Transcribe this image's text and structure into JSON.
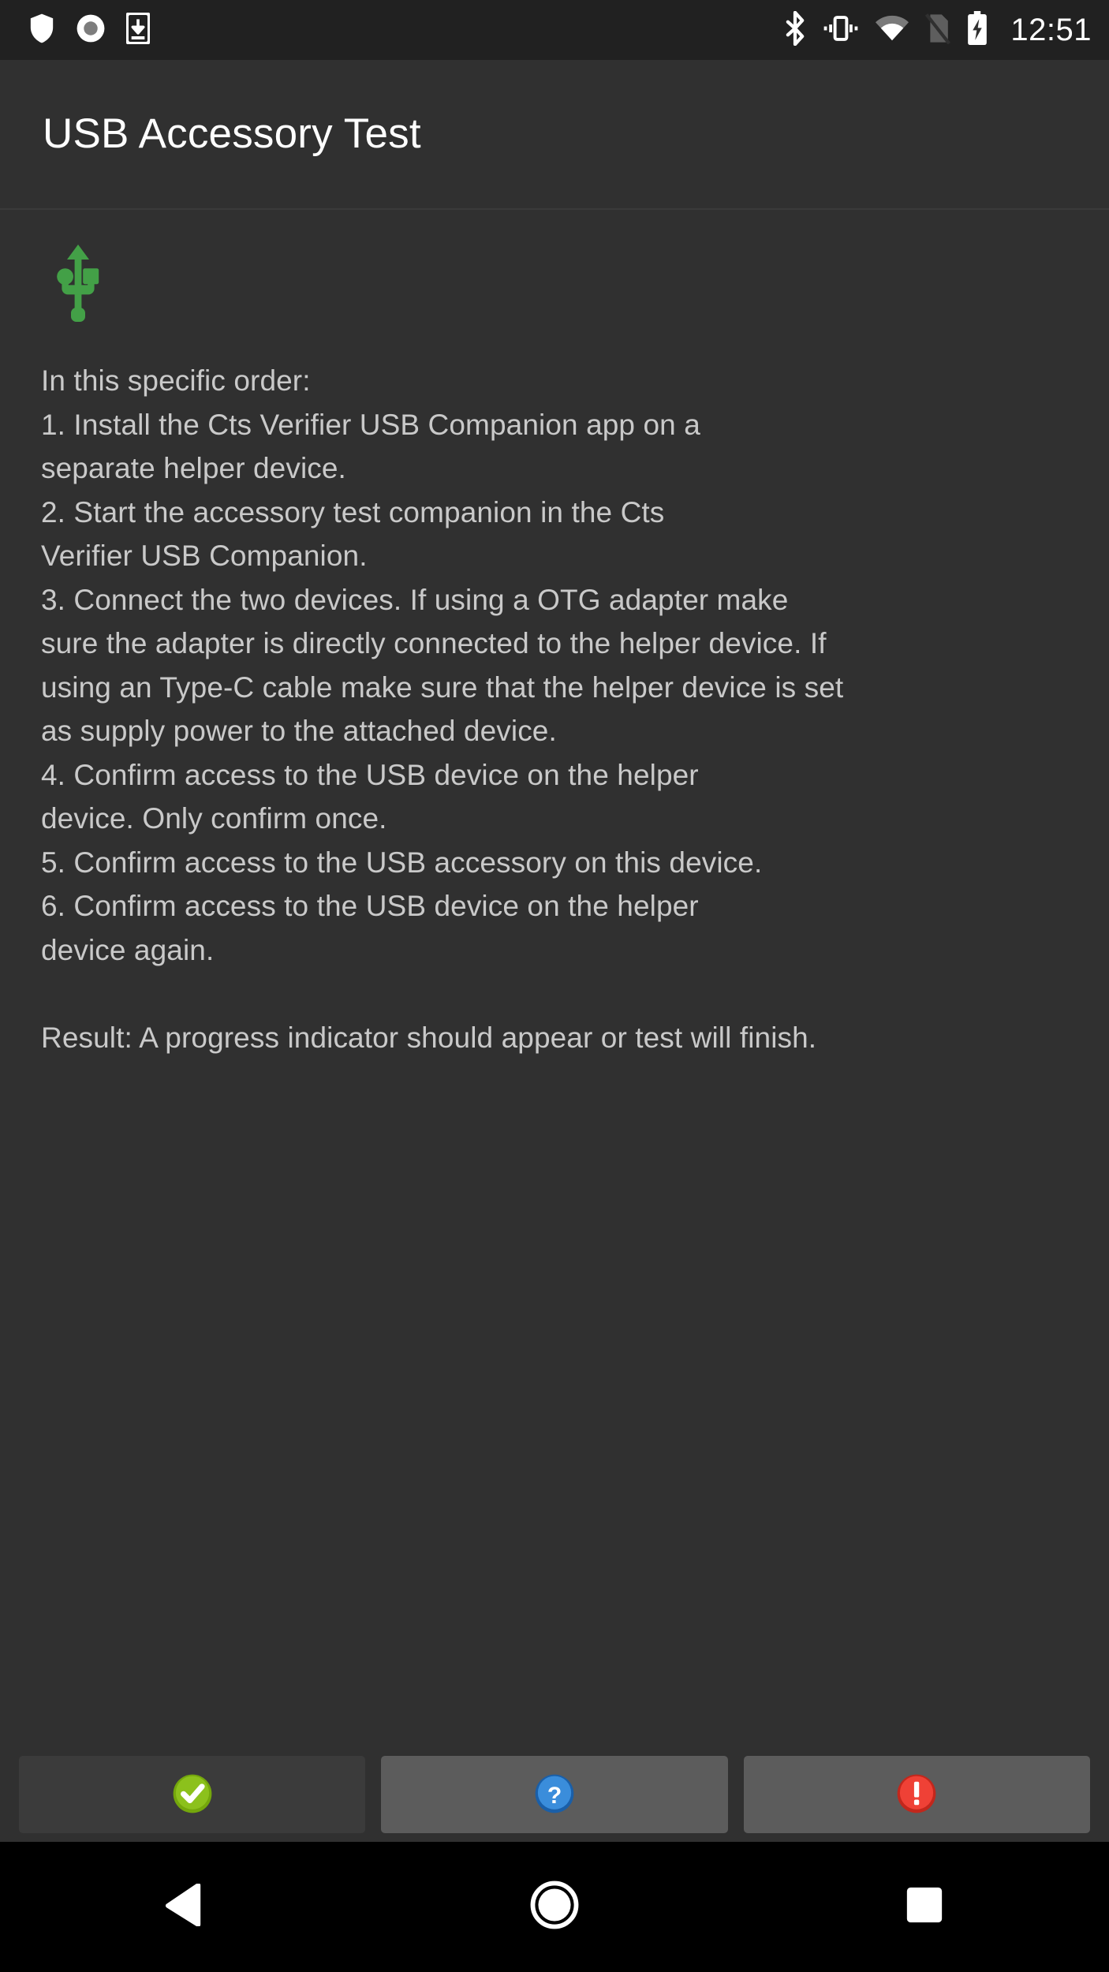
{
  "status_bar": {
    "left_icons": [
      {
        "name": "shield-icon",
        "label": "shield"
      },
      {
        "name": "screen-record-icon",
        "label": "screen record"
      },
      {
        "name": "download-to-device-icon",
        "label": "download to device"
      }
    ],
    "right_icons": [
      {
        "name": "bluetooth-icon",
        "label": "bluetooth"
      },
      {
        "name": "vibrate-icon",
        "label": "vibrate"
      },
      {
        "name": "wifi-icon",
        "label": "wifi"
      },
      {
        "name": "no-sim-icon",
        "label": "no sim"
      },
      {
        "name": "battery-charging-icon",
        "label": "battery charging"
      }
    ],
    "clock": "12:51"
  },
  "app_bar": {
    "title": "USB Accessory Test"
  },
  "content": {
    "usb_icon": "usb-icon",
    "instructions": "In this specific order:\n1. Install the Cts Verifier USB Companion app on a\nseparate helper device.\n2. Start the accessory test companion in the Cts\nVerifier USB Companion.\n3. Connect the two devices. If using a OTG adapter make\nsure the adapter is directly connected to the helper device. If\nusing an Type-C cable make sure that the helper device is set\nas supply power to the attached device.\n4. Confirm access to the USB device on the helper\ndevice. Only confirm once.\n5. Confirm access to the USB accessory on this device.\n6. Confirm access to the USB device on the helper\ndevice again.\n\nResult: A progress indicator should appear or test will finish."
  },
  "buttons": [
    {
      "name": "pass-button",
      "icon": "check-circle-icon",
      "label": "Pass"
    },
    {
      "name": "info-button",
      "icon": "question-circle-icon",
      "label": "Info"
    },
    {
      "name": "fail-button",
      "icon": "exclamation-circle-icon",
      "label": "Fail"
    }
  ],
  "nav_bar": [
    {
      "name": "nav-back-button",
      "icon": "back-triangle-icon",
      "label": "Back"
    },
    {
      "name": "nav-home-button",
      "icon": "home-circle-icon",
      "label": "Home"
    },
    {
      "name": "nav-recents-button",
      "icon": "recents-square-icon",
      "label": "Recents"
    }
  ],
  "colors": {
    "background": "#303030",
    "status_bar_bg": "#212121",
    "nav_bar_bg": "#000000",
    "text_primary": "#ffffff",
    "text_body": "#c9c9c9",
    "usb_green": "#43a047",
    "pass_green": "#8cc11c",
    "info_blue": "#2f86d4",
    "fail_red": "#ef4136"
  }
}
